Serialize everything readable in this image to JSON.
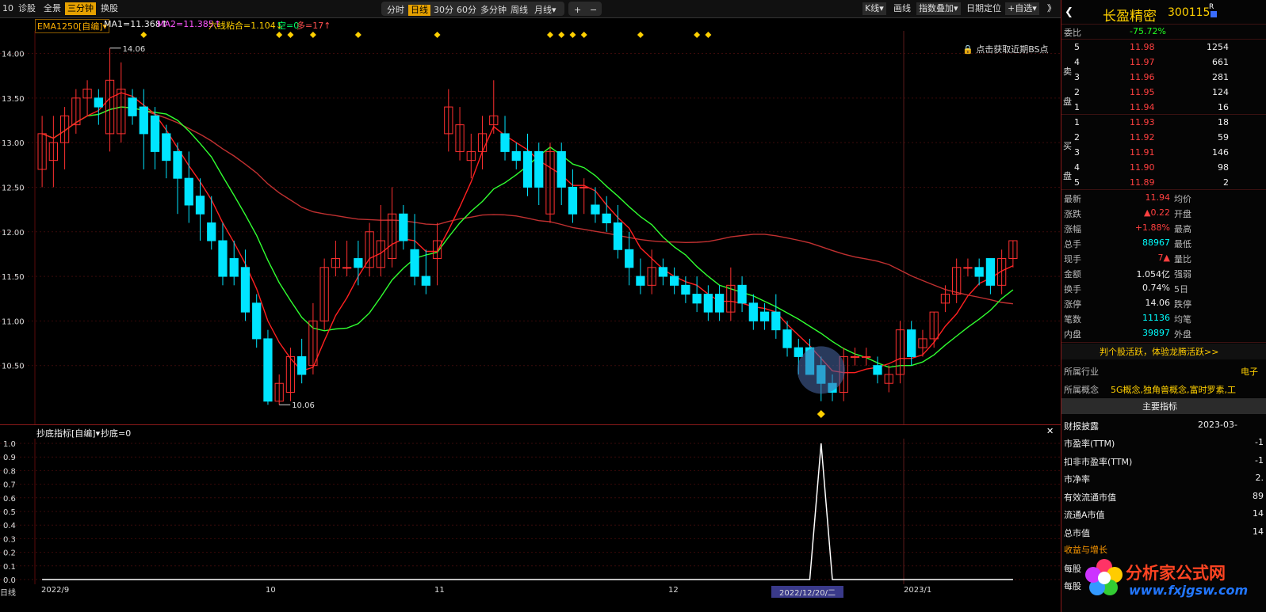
{
  "toolbar": {
    "left_items": [
      "10",
      "诊股",
      "全景",
      "三分钟",
      "换股"
    ],
    "active_left": "三分钟",
    "periods": [
      "分时",
      "日线",
      "30分",
      "60分",
      "多分钟",
      "周线",
      "月线▾"
    ],
    "active_period": "日线",
    "zoom_in": "+",
    "zoom_out": "−",
    "right_items": [
      "K线▾",
      "画线",
      "指数叠加▾",
      "日期定位",
      "+自选▾"
    ],
    "collapse": "》"
  },
  "main_indicator": {
    "name": "EMA1250[自编]▾",
    "ma1": "MA1=11.368↑",
    "ma2": "MA2=11.385↑",
    "six_line": "六线粘合=1.104↓",
    "kong": "空=0",
    "duo": "多=17↑",
    "lock_hint": "点击获取近期BS点",
    "high_label": "14.06",
    "low_label": "10.06",
    "y_ticks": [
      "14.00",
      "13.50",
      "13.00",
      "12.50",
      "12.00",
      "11.50",
      "11.00",
      "10.50"
    ],
    "colors": {
      "up": "#ff3030",
      "down": "#00e5ff",
      "ma_fast": "#ff2020",
      "ma_slow_green": "#30ff30",
      "ma_long": "#c03030",
      "marker": "#ffd000"
    }
  },
  "sub_indicator": {
    "name": "抄底指标[自编]▾",
    "value": "抄底=0",
    "y_ticks": [
      "1.0",
      "0.9",
      "0.8",
      "0.7",
      "0.6",
      "0.5",
      "0.4",
      "0.3",
      "0.2",
      "0.1",
      "0.0"
    ]
  },
  "x_axis": {
    "period": "日线",
    "labels": [
      "2022/9",
      "10",
      "11",
      "12",
      "2022/12/20/二",
      "2023/1"
    ]
  },
  "chart_data": {
    "type": "candlestick",
    "ylim": [
      10.0,
      14.2
    ],
    "candles": [
      [
        12.7,
        13.1,
        13.3,
        12.5
      ],
      [
        12.8,
        13.0,
        13.3,
        12.5
      ],
      [
        13.0,
        13.3,
        13.4,
        12.7
      ],
      [
        13.2,
        13.5,
        13.6,
        13.1
      ],
      [
        13.5,
        13.6,
        13.7,
        13.3
      ],
      [
        13.5,
        13.4,
        13.6,
        13.2
      ],
      [
        13.1,
        13.7,
        14.06,
        12.9
      ],
      [
        13.1,
        13.6,
        13.9,
        13.0
      ],
      [
        13.5,
        13.3,
        13.6,
        13.2
      ],
      [
        13.4,
        13.1,
        13.6,
        12.7
      ],
      [
        13.3,
        12.9,
        13.4,
        12.7
      ],
      [
        13.1,
        12.8,
        13.2,
        12.6
      ],
      [
        12.9,
        12.6,
        13.0,
        12.2
      ],
      [
        12.6,
        12.3,
        12.9,
        12.1
      ],
      [
        12.4,
        12.2,
        12.6,
        11.9
      ],
      [
        12.1,
        11.9,
        12.4,
        11.8
      ],
      [
        11.9,
        11.5,
        12.1,
        11.4
      ],
      [
        11.7,
        11.5,
        11.9,
        11.4
      ],
      [
        11.6,
        11.1,
        11.8,
        11.0
      ],
      [
        11.2,
        10.8,
        11.3,
        10.7
      ],
      [
        10.8,
        10.1,
        10.9,
        10.06
      ],
      [
        10.1,
        10.3,
        10.4,
        10.06
      ],
      [
        10.2,
        10.6,
        10.7,
        10.1
      ],
      [
        10.6,
        10.4,
        10.8,
        10.3
      ],
      [
        10.5,
        11.0,
        11.2,
        10.4
      ],
      [
        11.0,
        11.6,
        11.7,
        10.9
      ],
      [
        11.6,
        11.7,
        11.9,
        11.5
      ],
      [
        11.6,
        11.6,
        11.9,
        11.5
      ],
      [
        11.7,
        11.6,
        11.9,
        11.4
      ],
      [
        11.6,
        12.0,
        12.1,
        11.5
      ],
      [
        11.6,
        11.9,
        12.3,
        11.5
      ],
      [
        11.7,
        12.2,
        12.5,
        11.6
      ],
      [
        12.2,
        11.9,
        12.3,
        11.8
      ],
      [
        11.8,
        11.5,
        12.2,
        11.4
      ],
      [
        11.5,
        11.4,
        11.8,
        11.3
      ],
      [
        11.7,
        11.9,
        12.1,
        11.4
      ],
      [
        13.1,
        13.4,
        13.6,
        12.9
      ],
      [
        12.9,
        13.2,
        13.4,
        12.8
      ],
      [
        12.8,
        12.9,
        13.1,
        12.6
      ],
      [
        12.9,
        13.1,
        13.3,
        12.7
      ],
      [
        13.2,
        13.3,
        13.7,
        13.1
      ],
      [
        13.1,
        12.9,
        13.3,
        12.8
      ],
      [
        12.9,
        12.8,
        13.0,
        12.7
      ],
      [
        12.9,
        12.5,
        13.1,
        12.4
      ],
      [
        12.9,
        12.5,
        13.0,
        12.3
      ],
      [
        12.2,
        12.9,
        13.0,
        12.1
      ],
      [
        12.9,
        12.5,
        13.0,
        12.3
      ],
      [
        12.5,
        12.2,
        12.7,
        12.1
      ],
      [
        12.5,
        12.5,
        12.6,
        12.2
      ],
      [
        12.3,
        12.2,
        12.5,
        12.1
      ],
      [
        12.2,
        12.1,
        12.4,
        12.0
      ],
      [
        12.1,
        11.8,
        12.3,
        11.7
      ],
      [
        11.8,
        11.6,
        12.0,
        11.4
      ],
      [
        11.5,
        11.4,
        11.7,
        11.3
      ],
      [
        11.4,
        11.6,
        11.8,
        11.3
      ],
      [
        11.6,
        11.5,
        11.7,
        11.4
      ],
      [
        11.5,
        11.4,
        11.6,
        11.3
      ],
      [
        11.4,
        11.3,
        11.5,
        11.2
      ],
      [
        11.3,
        11.2,
        11.5,
        11.1
      ],
      [
        11.3,
        11.1,
        11.4,
        11.0
      ],
      [
        11.3,
        11.1,
        11.4,
        11.0
      ],
      [
        11.1,
        11.4,
        11.6,
        11.0
      ],
      [
        11.4,
        11.2,
        11.5,
        11.1
      ],
      [
        11.2,
        11.0,
        11.3,
        10.9
      ],
      [
        11.1,
        11.0,
        11.2,
        10.9
      ],
      [
        11.1,
        10.9,
        11.3,
        10.8
      ],
      [
        10.9,
        10.7,
        11.0,
        10.6
      ],
      [
        10.7,
        10.6,
        10.8,
        10.4
      ],
      [
        10.7,
        10.4,
        10.8,
        10.4
      ],
      [
        10.5,
        10.3,
        10.6,
        10.1
      ],
      [
        10.3,
        10.2,
        10.4,
        10.1
      ],
      [
        10.2,
        10.6,
        10.7,
        10.1
      ],
      [
        10.6,
        10.6,
        10.7,
        10.5
      ],
      [
        10.6,
        10.6,
        10.7,
        10.5
      ],
      [
        10.5,
        10.4,
        10.6,
        10.3
      ],
      [
        10.3,
        10.4,
        10.5,
        10.2
      ],
      [
        10.4,
        10.9,
        11.0,
        10.3
      ],
      [
        10.9,
        10.6,
        11.0,
        10.5
      ],
      [
        10.7,
        10.8,
        10.9,
        10.6
      ],
      [
        10.8,
        11.1,
        11.1,
        10.7
      ],
      [
        11.2,
        11.3,
        11.4,
        11.1
      ],
      [
        11.3,
        11.6,
        11.7,
        11.2
      ],
      [
        11.6,
        11.6,
        11.7,
        11.5
      ],
      [
        11.6,
        11.5,
        11.7,
        11.4
      ],
      [
        11.7,
        11.4,
        11.7,
        11.3
      ],
      [
        11.4,
        11.7,
        11.8,
        11.3
      ],
      [
        11.7,
        11.9,
        11.9,
        11.6
      ]
    ],
    "series": [
      {
        "name": "MA1",
        "values": [
          11.368
        ]
      },
      {
        "name": "MA2",
        "values": [
          11.385
        ]
      },
      {
        "name": "六线粘合",
        "values": [
          1.104
        ]
      }
    ],
    "sub_series": {
      "name": "抄底",
      "peak_index": 69,
      "peak_value": 1.0
    }
  },
  "right_panel": {
    "name": "长盈精密",
    "code": "300115",
    "badge": "R",
    "weibi_label": "委比",
    "weibi_value": "-75.72%",
    "sell_side": "卖盘",
    "buy_side": "买盘",
    "asks": [
      [
        "5",
        "11.98",
        "1254"
      ],
      [
        "4",
        "11.97",
        "661"
      ],
      [
        "3",
        "11.96",
        "281"
      ],
      [
        "2",
        "11.95",
        "124"
      ],
      [
        "1",
        "11.94",
        "16"
      ]
    ],
    "bids": [
      [
        "1",
        "11.93",
        "18"
      ],
      [
        "2",
        "11.92",
        "59"
      ],
      [
        "3",
        "11.91",
        "146"
      ],
      [
        "4",
        "11.90",
        "98"
      ],
      [
        "5",
        "11.89",
        "2"
      ]
    ],
    "stats": [
      [
        "最新",
        "11.94",
        "均价"
      ],
      [
        "涨跌",
        "▲0.22",
        "开盘"
      ],
      [
        "涨幅",
        "+1.88%",
        "最高"
      ],
      [
        "总手",
        "88967",
        "最低"
      ],
      [
        "现手",
        "7▲",
        "量比"
      ],
      [
        "金额",
        "1.054亿",
        "强弱"
      ],
      [
        "换手",
        "0.74%",
        "5日"
      ],
      [
        "涨停",
        "14.06",
        "跌停"
      ],
      [
        "笔数",
        "11136",
        "均笔"
      ],
      [
        "内盘",
        "39897",
        "外盘"
      ]
    ],
    "promo": "判个股活跃，体验龙腾活跃>>",
    "industry_label": "所属行业",
    "industry_value": "电子",
    "concept_label": "所属概念",
    "concept_value": "5G概念,独角兽概念,富时罗素,工",
    "main_indicator_btn": "主要指标",
    "report_label": "财报披露",
    "report_value": "2023-03-",
    "metrics": [
      [
        "市盈率(TTM)",
        "-1"
      ],
      [
        "扣非市盈率(TTM)",
        "-1"
      ],
      [
        "市净率",
        "2."
      ],
      [
        "有效流通市值",
        "89"
      ],
      [
        "流通A市值",
        "14"
      ],
      [
        "总市值",
        "14"
      ]
    ],
    "growth_label": "收益与增长",
    "eps_label": "每股",
    "eps_label2": "每股"
  },
  "logo": {
    "text": "分析家公式网",
    "url_text": "www.fxjgsw.com"
  }
}
